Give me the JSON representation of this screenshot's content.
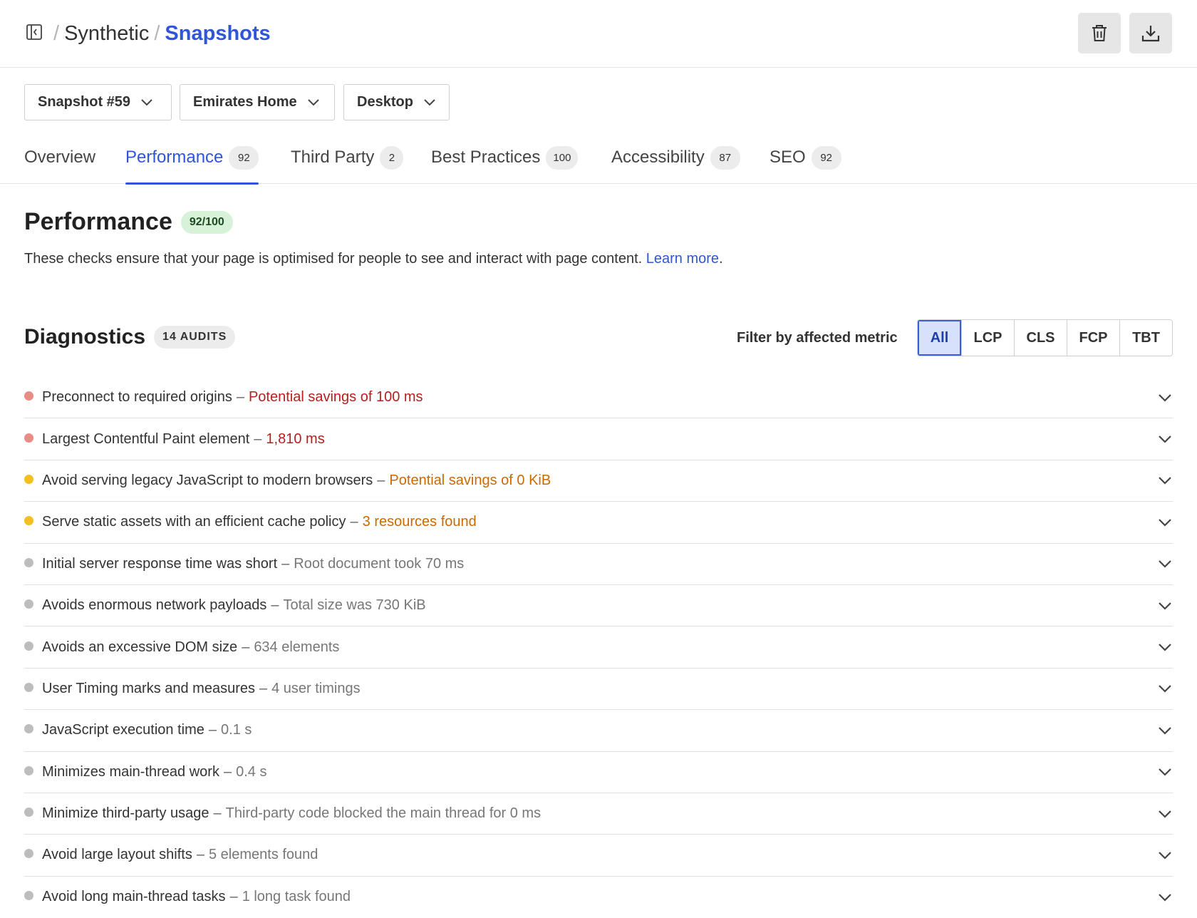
{
  "breadcrumb": {
    "root": "Synthetic",
    "separator": "/",
    "current": "Snapshots"
  },
  "actions": {
    "delete_icon": "trash-icon",
    "download_icon": "download-icon"
  },
  "selectors": {
    "snapshot": "Snapshot #59",
    "page": "Emirates Home",
    "device": "Desktop"
  },
  "tabs": [
    {
      "label": "Overview",
      "badge": null,
      "active": false
    },
    {
      "label": "Performance",
      "badge": "92",
      "active": true
    },
    {
      "label": "Third Party",
      "badge": "2",
      "active": false
    },
    {
      "label": "Best Practices",
      "badge": "100",
      "active": false
    },
    {
      "label": "Accessibility",
      "badge": "87",
      "active": false
    },
    {
      "label": "SEO",
      "badge": "92",
      "active": false
    }
  ],
  "performance": {
    "title": "Performance",
    "score": "92/100",
    "description": "These checks ensure that your page is optimised for people to see and interact with page content.",
    "learn_more": "Learn more",
    "learn_more_suffix": "."
  },
  "diagnostics": {
    "title": "Diagnostics",
    "count_label": "14 AUDITS",
    "filter_label": "Filter by affected metric",
    "filters": [
      "All",
      "LCP",
      "CLS",
      "FCP",
      "TBT"
    ],
    "active_filter": "All",
    "audits": [
      {
        "name": "Preconnect to required origins",
        "detail": "Potential savings of 100 ms",
        "severity": "red"
      },
      {
        "name": "Largest Contentful Paint element",
        "detail": "1,810 ms",
        "severity": "red"
      },
      {
        "name": "Avoid serving legacy JavaScript to modern browsers",
        "detail": "Potential savings of 0 KiB",
        "severity": "yellow"
      },
      {
        "name": "Serve static assets with an efficient cache policy",
        "detail": "3 resources found",
        "severity": "yellow"
      },
      {
        "name": "Initial server response time was short",
        "detail": "Root document took 70 ms",
        "severity": "gray"
      },
      {
        "name": "Avoids enormous network payloads",
        "detail": "Total size was 730 KiB",
        "severity": "gray"
      },
      {
        "name": "Avoids an excessive DOM size",
        "detail": "634 elements",
        "severity": "gray"
      },
      {
        "name": "User Timing marks and measures",
        "detail": "4 user timings",
        "severity": "gray"
      },
      {
        "name": "JavaScript execution time",
        "detail": "0.1 s",
        "severity": "gray"
      },
      {
        "name": "Minimizes main-thread work",
        "detail": "0.4 s",
        "severity": "gray"
      },
      {
        "name": "Minimize third-party usage",
        "detail": "Third-party code blocked the main thread for 0 ms",
        "severity": "gray"
      },
      {
        "name": "Avoid large layout shifts",
        "detail": "5 elements found",
        "severity": "gray"
      },
      {
        "name": "Avoid long main-thread tasks",
        "detail": "1 long task found",
        "severity": "gray"
      }
    ]
  },
  "colors": {
    "accent": "#2f56d8",
    "red_dot": "#e98c86",
    "yellow_dot": "#f3c01f",
    "gray_dot": "#bdbdbd",
    "red_text": "#b5201e",
    "orange_text": "#cc6a00",
    "score_pill_bg": "#d8f1d9"
  }
}
